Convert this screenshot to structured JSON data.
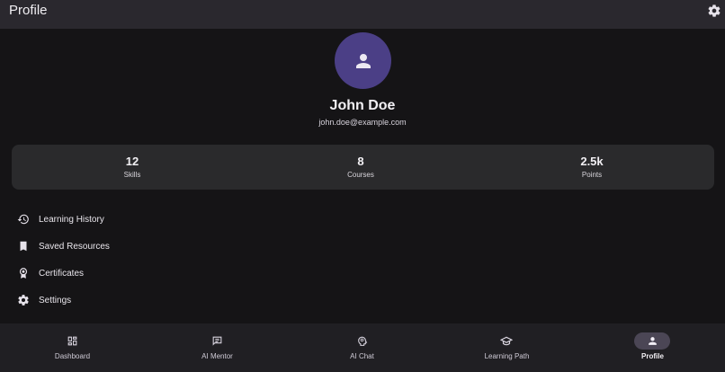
{
  "appbar": {
    "title": "Profile",
    "settings_icon": "gear-icon"
  },
  "profile": {
    "avatar_icon": "person-icon",
    "name": "John Doe",
    "email": "john.doe@example.com"
  },
  "stats": [
    {
      "value": "12",
      "label": "Skills"
    },
    {
      "value": "8",
      "label": "Courses"
    },
    {
      "value": "2.5k",
      "label": "Points"
    }
  ],
  "menu": [
    {
      "icon": "history-icon",
      "label": "Learning History"
    },
    {
      "icon": "bookmark-icon",
      "label": "Saved Resources"
    },
    {
      "icon": "certificate-icon",
      "label": "Certificates"
    },
    {
      "icon": "gear-icon",
      "label": "Settings"
    }
  ],
  "nav": [
    {
      "icon": "dashboard-icon",
      "label": "Dashboard",
      "active": false
    },
    {
      "icon": "chat-bubble-icon",
      "label": "AI Mentor",
      "active": false
    },
    {
      "icon": "head-lightbulb-icon",
      "label": "AI Chat",
      "active": false
    },
    {
      "icon": "graduation-cap-icon",
      "label": "Learning Path",
      "active": false
    },
    {
      "icon": "person-icon",
      "label": "Profile",
      "active": true
    }
  ],
  "colors": {
    "accent": "#4b3f86",
    "background": "#151416",
    "appbar": "#2a282e",
    "card": "#2a2a2c",
    "nav": "#201f23"
  }
}
